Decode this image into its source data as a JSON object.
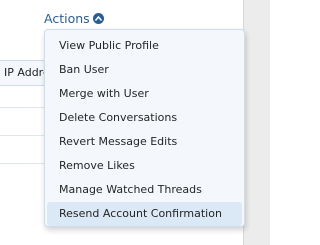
{
  "actions": {
    "label": "Actions"
  },
  "background": {
    "ip_column_header": "IP Addre"
  },
  "menu": {
    "items": [
      {
        "label": "View Public Profile"
      },
      {
        "label": "Ban User"
      },
      {
        "label": "Merge with User"
      },
      {
        "label": "Delete Conversations"
      },
      {
        "label": "Revert Message Edits"
      },
      {
        "label": "Remove Likes"
      },
      {
        "label": "Manage Watched Threads"
      },
      {
        "label": "Resend Account Confirmation"
      }
    ],
    "active_index": 7
  },
  "colors": {
    "link": "#2b5d95",
    "menu_bg": "#f4f8fc",
    "menu_hover": "#dbe8f5",
    "menu_border": "#cfdce9"
  }
}
